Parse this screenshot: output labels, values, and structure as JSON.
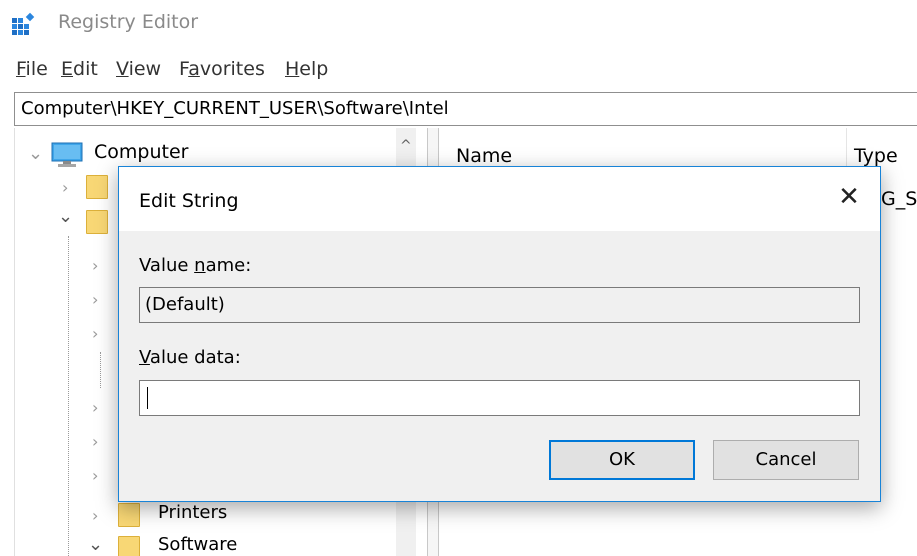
{
  "window": {
    "title": "Registry Editor"
  },
  "menu": [
    {
      "pre": "",
      "key": "F",
      "post": "ile"
    },
    {
      "pre": "",
      "key": "E",
      "post": "dit"
    },
    {
      "pre": "",
      "key": "V",
      "post": "iew"
    },
    {
      "pre": "F",
      "key": "a",
      "post": "vorites"
    },
    {
      "pre": "",
      "key": "H",
      "post": "elp"
    }
  ],
  "address": {
    "path": "Computer\\HKEY_CURRENT_USER\\Software\\Intel"
  },
  "tree": {
    "root_label": "Computer",
    "printers_label": "Printers",
    "software_label": "Software",
    "expanded_glyph": "⌄",
    "collapsed_glyph": "›",
    "scroll_up_glyph": "^"
  },
  "list": {
    "columns": [
      "Name",
      "Type"
    ],
    "partial_type_text": "EG_S"
  },
  "dialog": {
    "title": "Edit String",
    "close_glyph": "✕",
    "value_name_label": {
      "pre": "Value ",
      "key": "n",
      "post": "ame:"
    },
    "value_name": "(Default)",
    "value_data_label": {
      "pre": "",
      "key": "V",
      "post": "alue data:"
    },
    "value_data": "",
    "ok_label": "OK",
    "cancel_label": "Cancel"
  },
  "colors": {
    "accent": "#0078d7",
    "dialog_border": "#1883d7",
    "folder": "#f8d775"
  }
}
